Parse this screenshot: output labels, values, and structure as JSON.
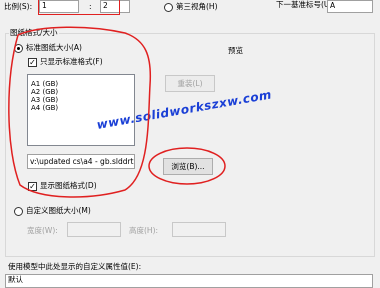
{
  "top": {
    "scale_label": "比例(S):",
    "scale_a": "1",
    "scale_sep": ":",
    "scale_b": "2",
    "third_angle_label": "第三视角(H)",
    "next_datum_label": "下一基准标号(U):",
    "next_datum_value": "A"
  },
  "sheet_format": {
    "group_label": "图纸格式/大小",
    "standard_label": "标准图纸大小(A)",
    "only_standard_label": "只显示标准格式(F)",
    "sizes": [
      "A1 (GB)",
      "A2 (GB)",
      "A3 (GB)",
      "A4 (GB)"
    ],
    "reload_label": "重装(L)",
    "path_value": "v:\\updated cs\\a4 - gb.slddrt",
    "browse_label": "浏览(B)...",
    "display_format_label": "显示图纸格式(D)",
    "custom_label": "自定义图纸大小(M)",
    "width_label": "宽度(W):",
    "height_label": "高度(H):"
  },
  "preview": {
    "label": "预览"
  },
  "watermark": "www.solidworkszxw.com",
  "bottom": {
    "custom_prop_label": "使用模型中此处显示的自定义属性值(E):",
    "custom_prop_value": "默认"
  },
  "colors": {
    "annotation": "#e02020",
    "watermark": "#1a3fd6"
  }
}
